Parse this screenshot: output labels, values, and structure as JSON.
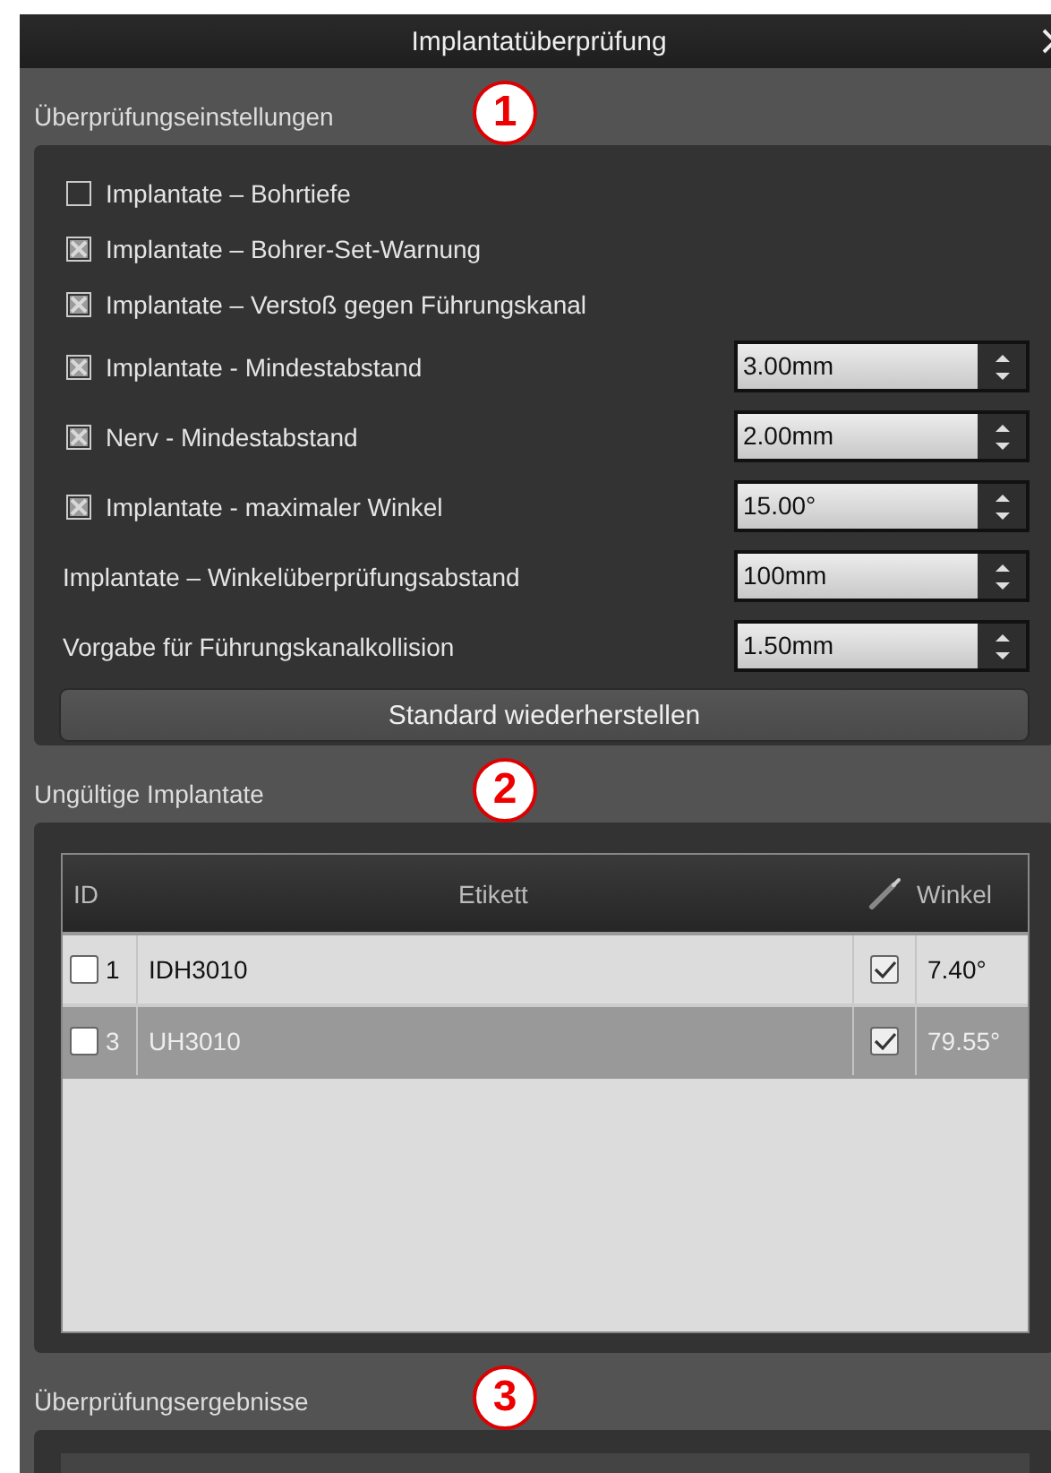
{
  "window": {
    "title": "Implantatüberprüfung"
  },
  "settings": {
    "title": "Überprüfungseinstellungen",
    "callout": "1",
    "items": [
      {
        "kind": "check",
        "label": "Implantate – Bohrtiefe",
        "checked": false
      },
      {
        "kind": "check",
        "label": "Implantate – Bohrer-Set-Warnung",
        "checked": true
      },
      {
        "kind": "check",
        "label": "Implantate – Verstoß gegen Führungskanal",
        "checked": true
      },
      {
        "kind": "check-spin",
        "label": "Implantate - Mindestabstand",
        "checked": true,
        "value": "3.00mm"
      },
      {
        "kind": "check-spin",
        "label": "Nerv - Mindestabstand",
        "checked": true,
        "value": "2.00mm"
      },
      {
        "kind": "check-spin",
        "label": "Implantate - maximaler Winkel",
        "checked": true,
        "value": "15.00°"
      },
      {
        "kind": "spin",
        "label": "Implantate – Winkelüberprüfungsabstand",
        "value": "100mm"
      },
      {
        "kind": "spin",
        "label": "Vorgabe für Führungskanalkollision",
        "value": "1.50mm"
      }
    ],
    "reset_button": "Standard wiederherstellen"
  },
  "invalid_implants": {
    "title": "Ungültige Implantate",
    "callout": "2",
    "table": {
      "columns": [
        "ID",
        "Etikett",
        "Winkel"
      ],
      "rows": [
        {
          "checked": false,
          "id": "1",
          "label": "IDH3010",
          "flag_checked": true,
          "angle": "7.40°",
          "selected": false
        },
        {
          "checked": false,
          "id": "3",
          "label": "UH3010",
          "flag_checked": true,
          "angle": "79.55°",
          "selected": true
        }
      ]
    }
  },
  "results": {
    "title": "Überprüfungsergebnisse",
    "callout": "3"
  }
}
